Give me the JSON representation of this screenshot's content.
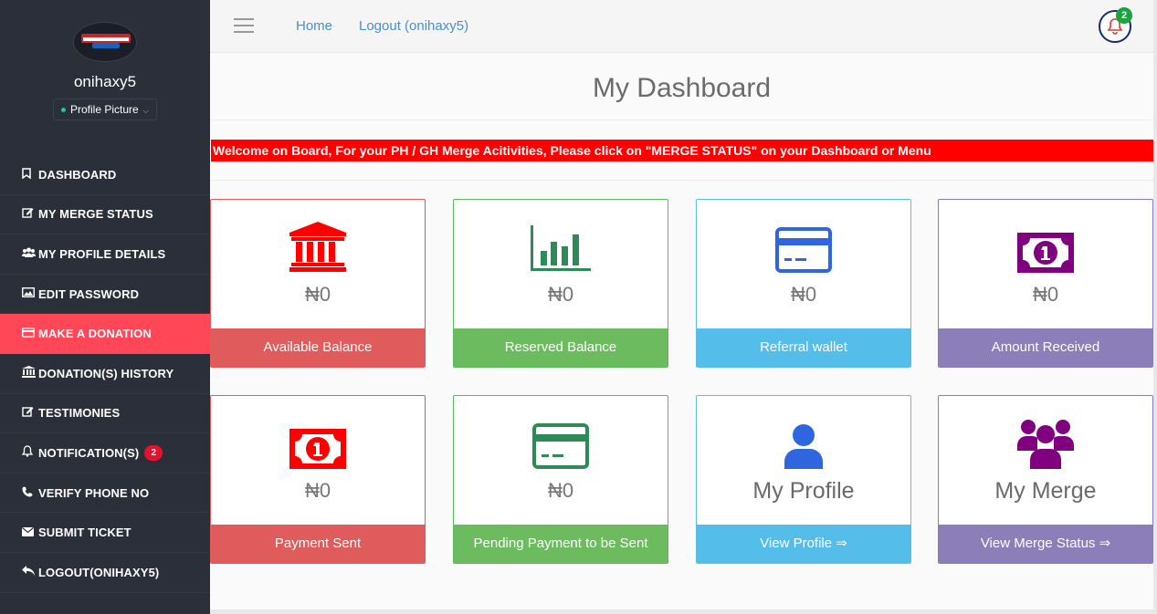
{
  "sidebar": {
    "username": "onihaxy5",
    "profile_button": "Profile Picture",
    "items": [
      {
        "label": "DASHBOARD",
        "icon": "bookmark-icon"
      },
      {
        "label": "MY MERGE STATUS",
        "icon": "edit-icon"
      },
      {
        "label": "MY PROFILE DETAILS",
        "icon": "users-icon"
      },
      {
        "label": "EDIT PASSWORD",
        "icon": "image-icon"
      },
      {
        "label": "MAKE A DONATION",
        "icon": "credit-card-icon"
      },
      {
        "label": "DONATION(S) HISTORY",
        "icon": "bank-icon"
      },
      {
        "label": "TESTIMONIES",
        "icon": "edit-icon"
      },
      {
        "label": "NOTIFICATION(S)",
        "icon": "bell-icon",
        "badge": "2"
      },
      {
        "label": "VERIFY PHONE NO",
        "icon": "phone-icon"
      },
      {
        "label": "SUBMIT TICKET",
        "icon": "envelope-icon"
      },
      {
        "label": "LOGOUT(ONIHAXY5)",
        "icon": "reply-icon"
      }
    ]
  },
  "topbar": {
    "home": "Home",
    "logout": "Logout (onihaxy5)",
    "notif_count": "2"
  },
  "main": {
    "title": "My Dashboard",
    "welcome": "Welcome on Board, For your PH / GH Merge Acitivities, Please click on \"MERGE STATUS\" on your Dashboard or Menu",
    "cards": [
      {
        "value": "₦0",
        "label": "Available Balance",
        "icon": "bank-icon",
        "color": "#ff0000"
      },
      {
        "value": "₦0",
        "label": "Reserved Balance",
        "icon": "bar-chart-icon",
        "color": "#2e8b57"
      },
      {
        "value": "₦0",
        "label": "Referral wallet",
        "icon": "credit-card-icon",
        "color": "#2f66e0"
      },
      {
        "value": "₦0",
        "label": "Amount Received",
        "icon": "money-icon",
        "color": "#800080"
      },
      {
        "value": "₦0",
        "label": "Payment Sent",
        "icon": "money-icon",
        "color": "#ff0000"
      },
      {
        "value": "₦0",
        "label": "Pending Payment to be Sent",
        "icon": "credit-card-icon",
        "color": "#2e8b57"
      },
      {
        "value": "My Profile",
        "label": "View Profile ⇒",
        "icon": "user-icon",
        "color": "#2f66e0"
      },
      {
        "value": "My Merge",
        "label": "View Merge Status ⇒",
        "icon": "users-icon",
        "color": "#800080"
      }
    ]
  }
}
